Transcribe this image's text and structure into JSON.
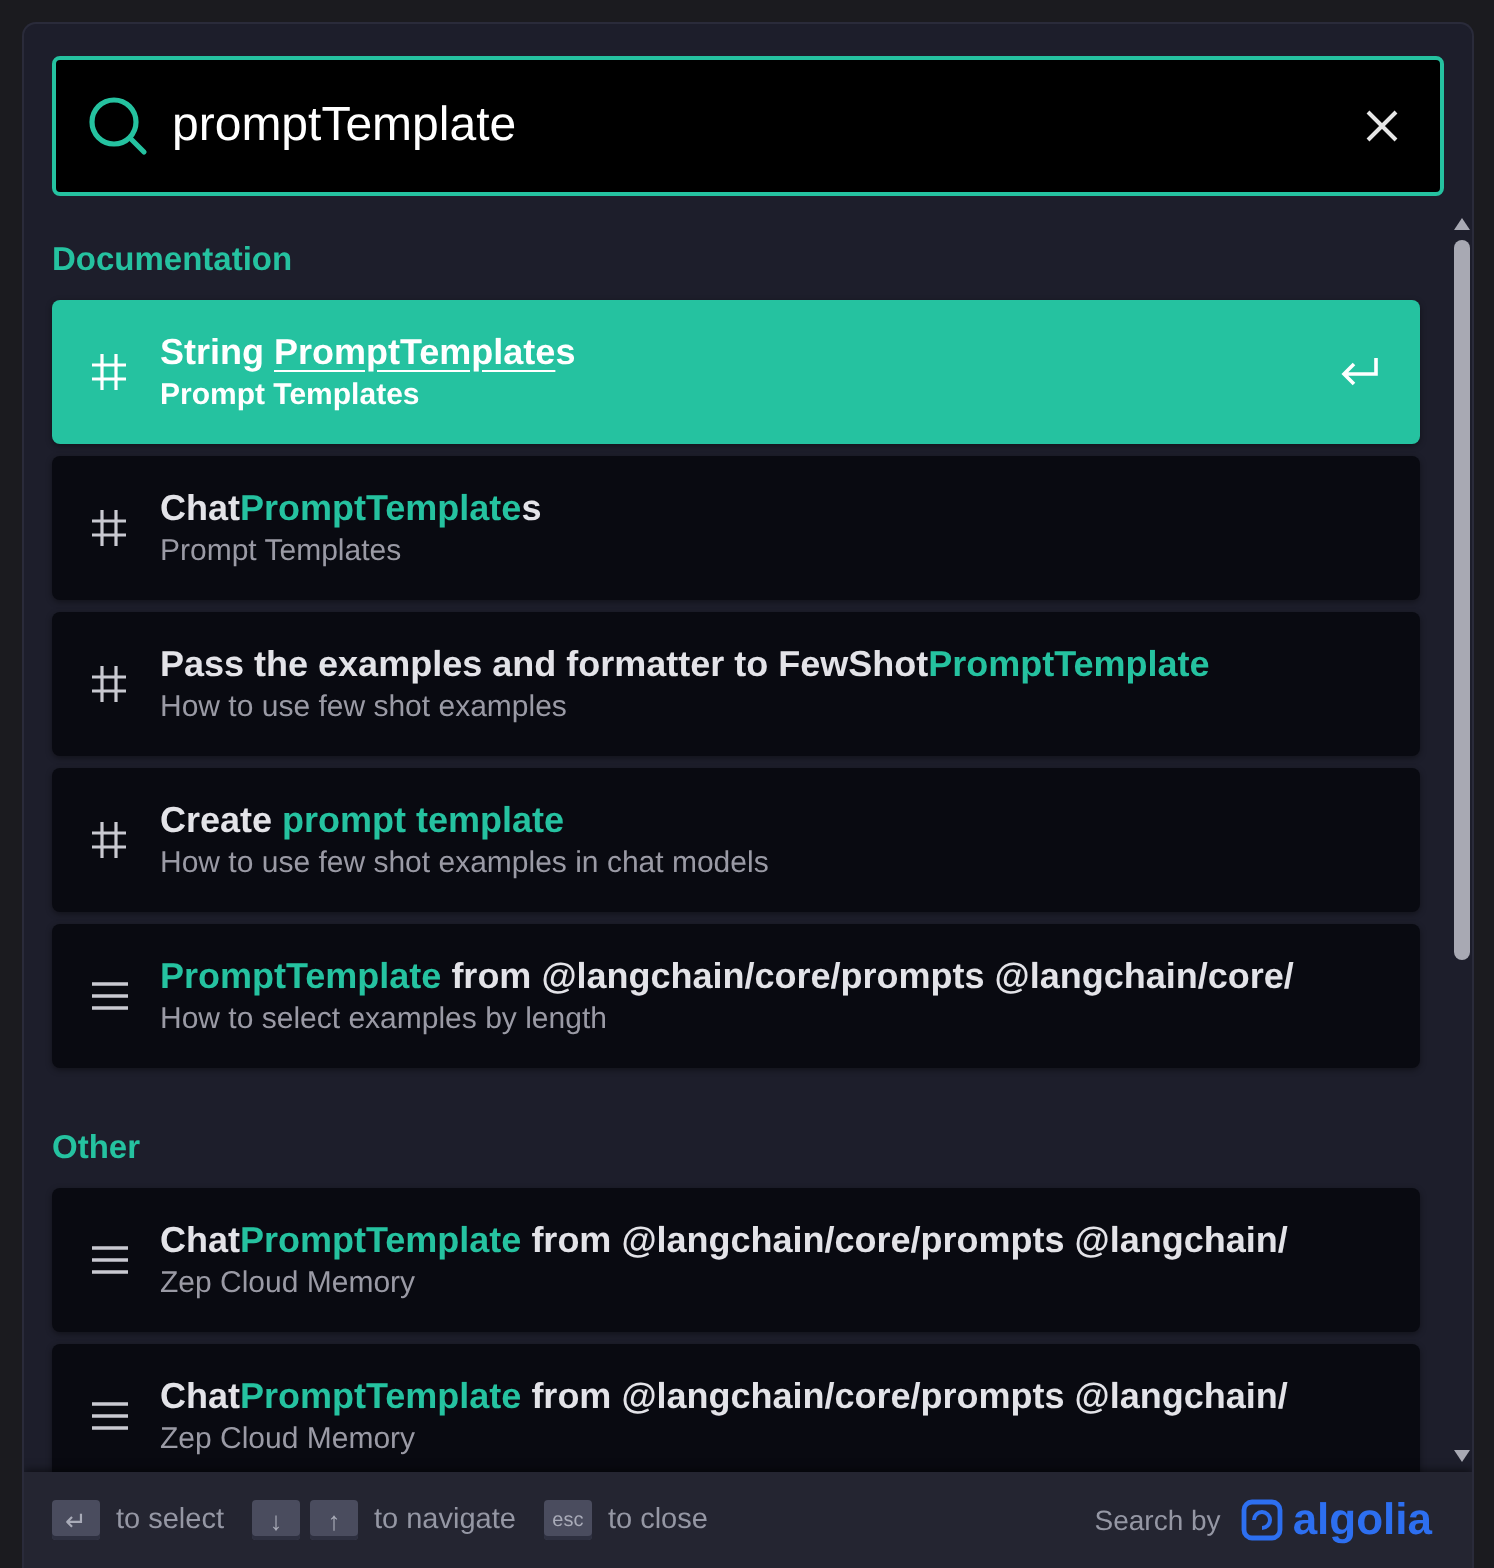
{
  "search": {
    "value": "promptTemplate"
  },
  "sections": [
    {
      "title": "Documentation",
      "hits": [
        {
          "kind": "hash",
          "selected": true,
          "title": [
            {
              "text": "String ",
              "highlight": false
            },
            {
              "text": "PromptTemplate",
              "highlight": true
            },
            {
              "text": "s",
              "highlight": false
            }
          ],
          "subtitle": "Prompt Templates"
        },
        {
          "kind": "hash",
          "selected": false,
          "title": [
            {
              "text": "Chat",
              "highlight": false
            },
            {
              "text": "PromptTemplate",
              "highlight": true
            },
            {
              "text": "s",
              "highlight": false
            }
          ],
          "subtitle": "Prompt Templates"
        },
        {
          "kind": "hash",
          "selected": false,
          "title": [
            {
              "text": "Pass the examples and formatter to FewShot",
              "highlight": false
            },
            {
              "text": "PromptTemplate",
              "highlight": true
            }
          ],
          "subtitle": "How to use few shot examples"
        },
        {
          "kind": "hash",
          "selected": false,
          "title": [
            {
              "text": "Create ",
              "highlight": false
            },
            {
              "text": "prompt template",
              "highlight": true
            }
          ],
          "subtitle": "How to use few shot examples in chat models"
        },
        {
          "kind": "content",
          "selected": false,
          "title": [
            {
              "text": "PromptTemplate",
              "highlight": true
            },
            {
              "text": " from @langchain/core/prompts @langchain/core/",
              "highlight": false
            }
          ],
          "subtitle": "How to select examples by length"
        }
      ]
    },
    {
      "title": "Other",
      "hits": [
        {
          "kind": "content",
          "selected": false,
          "title": [
            {
              "text": "Chat",
              "highlight": false
            },
            {
              "text": "PromptTemplate",
              "highlight": true
            },
            {
              "text": " from @langchain/core/prompts @langchain/",
              "highlight": false
            }
          ],
          "subtitle": "Zep Cloud Memory"
        },
        {
          "kind": "content",
          "selected": false,
          "title": [
            {
              "text": "Chat",
              "highlight": false
            },
            {
              "text": "PromptTemplate",
              "highlight": true
            },
            {
              "text": " from @langchain/core/prompts @langchain/",
              "highlight": false
            }
          ],
          "subtitle": "Zep Cloud Memory"
        }
      ]
    }
  ],
  "footer": {
    "commands": [
      {
        "keys": [
          "↵"
        ],
        "label": "to select"
      },
      {
        "keys": [
          "↓",
          "↑"
        ],
        "label": "to navigate"
      },
      {
        "keys": [
          "esc"
        ],
        "label": "to close"
      }
    ],
    "search_by": "Search by",
    "logo": "algolia"
  }
}
